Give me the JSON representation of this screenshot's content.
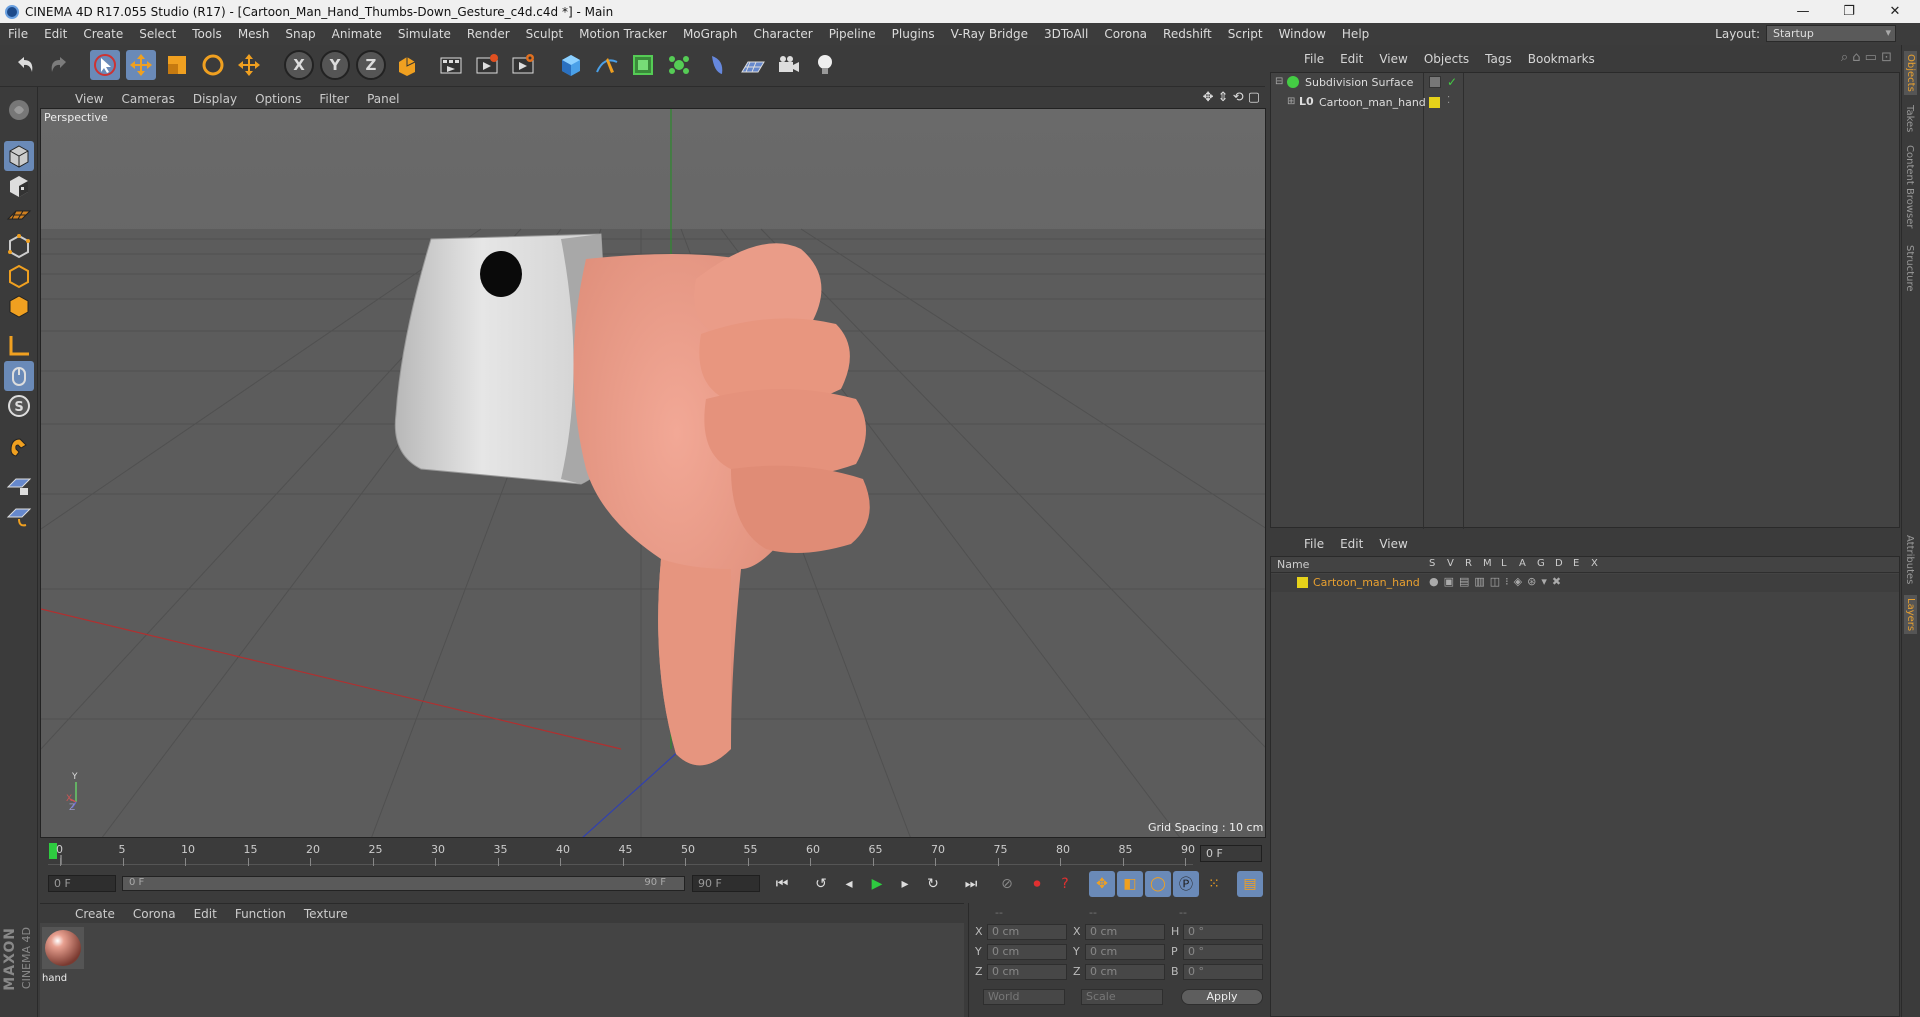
{
  "window": {
    "title": "CINEMA 4D R17.055 Studio (R17) - [Cartoon_Man_Hand_Thumbs-Down_Gesture_c4d.c4d *] - Main",
    "minimize": "—",
    "restore": "❐",
    "close": "✕"
  },
  "menubar": {
    "items": [
      "File",
      "Edit",
      "Create",
      "Select",
      "Tools",
      "Mesh",
      "Snap",
      "Animate",
      "Simulate",
      "Render",
      "Sculpt",
      "Motion Tracker",
      "MoGraph",
      "Character",
      "Pipeline",
      "Plugins",
      "V-Ray Bridge",
      "3DToAll",
      "Corona",
      "Redshift",
      "Script",
      "Window",
      "Help"
    ],
    "layout_label": "Layout:",
    "layout_value": "Startup"
  },
  "toolbar": {
    "x_label": "X",
    "y_label": "Y",
    "z_label": "Z"
  },
  "viewport": {
    "menu": [
      "View",
      "Cameras",
      "Display",
      "Options",
      "Filter",
      "Panel"
    ],
    "label": "Perspective",
    "grid_spacing": "Grid Spacing : 10 cm",
    "axis_y": "Y",
    "axis_x": "X",
    "axis_z": "Z"
  },
  "timeline": {
    "ticks": [
      "0",
      "5",
      "10",
      "15",
      "20",
      "25",
      "30",
      "35",
      "40",
      "45",
      "50",
      "55",
      "60",
      "65",
      "70",
      "75",
      "80",
      "85",
      "90"
    ],
    "current_frame": "0 F",
    "start_field": "0 F",
    "range_start": "0 F",
    "range_end": "90 F",
    "end_field": "90 F"
  },
  "materials": {
    "menu": [
      "Create",
      "Corona",
      "Edit",
      "Function",
      "Texture"
    ],
    "items": [
      {
        "name": "hand"
      }
    ]
  },
  "coordinates": {
    "header": [
      "--",
      "--",
      "--"
    ],
    "rows": [
      {
        "l1": "X",
        "v1": "0 cm",
        "l2": "X",
        "v2": "0 cm",
        "l3": "H",
        "v3": "0 °"
      },
      {
        "l1": "Y",
        "v1": "0 cm",
        "l2": "Y",
        "v2": "0 cm",
        "l3": "P",
        "v3": "0 °"
      },
      {
        "l1": "Z",
        "v1": "0 cm",
        "l2": "Z",
        "v2": "0 cm",
        "l3": "B",
        "v3": "0 °"
      }
    ],
    "mode": "World",
    "scale": "Scale",
    "apply": "Apply"
  },
  "objects_panel": {
    "menu": [
      "File",
      "Edit",
      "View",
      "Objects",
      "Tags",
      "Bookmarks"
    ],
    "items": [
      {
        "name": "Subdivision Surface"
      },
      {
        "name": "Cartoon_man_hand"
      }
    ]
  },
  "layers_panel": {
    "menu": [
      "File",
      "Edit",
      "View"
    ],
    "col_name": "Name",
    "cols": [
      "S",
      "V",
      "R",
      "M",
      "L",
      "A",
      "G",
      "D",
      "E",
      "X"
    ],
    "items": [
      {
        "name": "Cartoon_man_hand",
        "color": "#e6d21a"
      }
    ]
  },
  "side_tabs": [
    "Objects",
    "Takes",
    "Content Browser",
    "Structure",
    "Attributes",
    "Layers"
  ],
  "brand": {
    "maxon": "MAXON",
    "c4d": "CINEMA 4D"
  },
  "colors": {
    "accent": "#e8a030",
    "active_tool": "#6a8ab8",
    "layer_text": "#e8a030"
  }
}
